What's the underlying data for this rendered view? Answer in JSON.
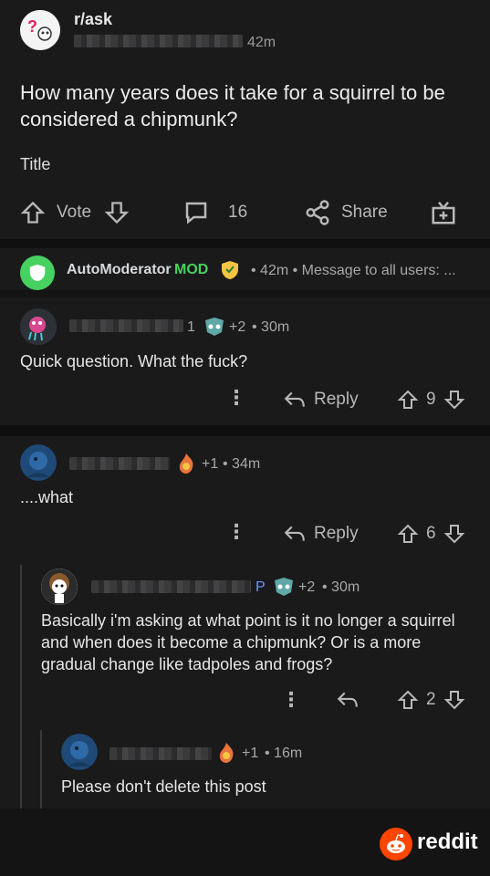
{
  "post": {
    "subreddit": "r/ask",
    "time": "42m",
    "title": "How many years does it take for a squirrel to be considered a chipmunk?",
    "body": "Title",
    "vote_label": "Vote",
    "comment_count": "16",
    "share_label": "Share"
  },
  "automod": {
    "name": "AutoModerator",
    "tag": "MOD",
    "meta": "• 42m • Message to all users: ..."
  },
  "comments": [
    {
      "flair_digit": "1",
      "karma": "+2",
      "time": "• 30m",
      "text": "Quick question. What the fuck?",
      "reply_label": "Reply",
      "score": "9"
    },
    {
      "karma": "+1",
      "time": "• 34m",
      "text": "....what",
      "reply_label": "Reply",
      "score": "6"
    },
    {
      "flair_letter": "P",
      "karma": "+2",
      "time": "• 30m",
      "text": "Basically i'm asking at what point is it no longer a squirrel and when does it become a chipmunk?  Or is a more gradual change like tadpoles and frogs?",
      "score": "2"
    },
    {
      "karma": "+1",
      "time": "• 16m",
      "text": "Please don't delete this post"
    }
  ],
  "footer": {
    "brand": "reddit"
  },
  "colors": {
    "background": "#1a1a1b",
    "mod_green": "#46d160",
    "reddit_orange": "#ff4500"
  }
}
